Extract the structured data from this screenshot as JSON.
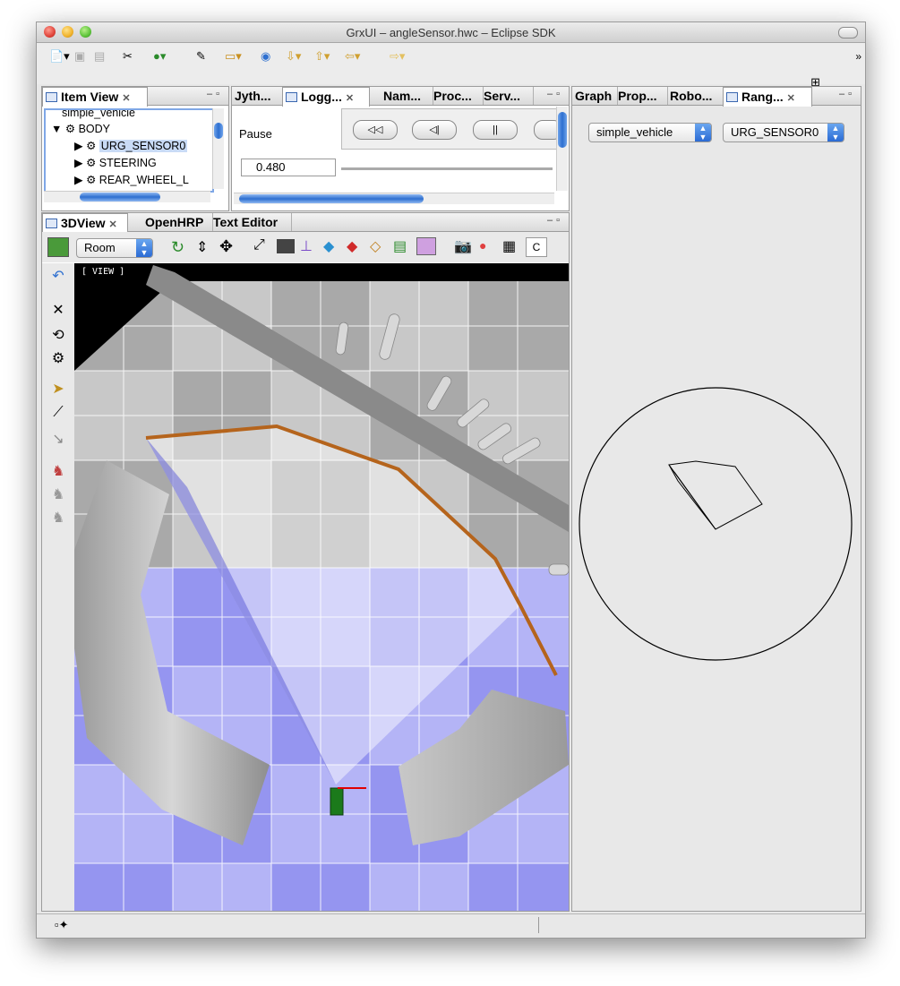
{
  "window": {
    "title": "GrxUI – angleSensor.hwc – Eclipse SDK"
  },
  "toolbar": {
    "chevron": "»"
  },
  "item_view": {
    "tab": "Item View",
    "items": [
      {
        "label": "simple_vehicle"
      },
      {
        "label": "BODY"
      },
      {
        "label": "URG_SENSOR0"
      },
      {
        "label": "STEERING"
      },
      {
        "label": "REAR_WHEEL_L"
      }
    ]
  },
  "top_center": {
    "tabs": [
      "Jyth...",
      "Logg...",
      "Nam...",
      "Proc...",
      "Serv..."
    ],
    "pause_label": "Pause",
    "time_value": "0.480",
    "media_buttons": [
      "◁◁",
      "◁|",
      "||"
    ]
  },
  "right_panel": {
    "tabs": [
      "Graph",
      "Prop...",
      "Robo...",
      "Rang..."
    ],
    "robot_select": "simple_vehicle",
    "sensor_select": "URG_SENSOR0"
  },
  "view3d": {
    "tabs": [
      "3DView",
      "OpenHRP",
      "Text Editor"
    ],
    "view_mode": "Room",
    "view_label": "[ VIEW ]",
    "c_button": "C"
  },
  "colors": {
    "accent": "#3b78d8",
    "path": "#b5641c",
    "floor_blue": "#8a8af0"
  }
}
